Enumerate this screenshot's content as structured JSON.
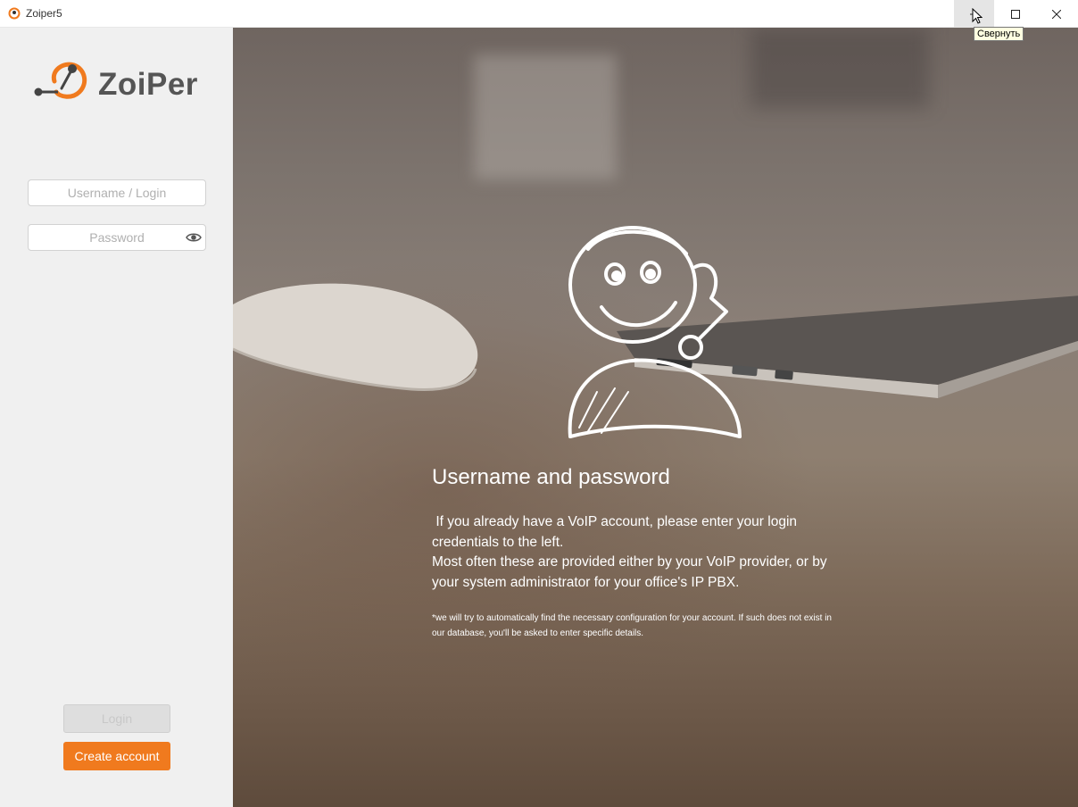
{
  "window": {
    "title": "Zoiper5",
    "tooltip": "Свернуть"
  },
  "sidebar": {
    "logo_text": "ZoiPer",
    "username_placeholder": "Username / Login",
    "password_placeholder": "Password",
    "login_label": "Login",
    "create_account_label": "Create account"
  },
  "hero": {
    "title": "Username and password",
    "body_line1": " If you already have a VoIP account, please enter your login credentials to the left.",
    "body_line2": "Most often these are provided either by your VoIP provider, or by your system administrator for your office's IP PBX.",
    "note": "*we will try to automatically find the necessary configuration for your account. If such does not exist in our database, you'll be asked to enter specific details."
  },
  "colors": {
    "accent": "#f07a1e",
    "sidebar_bg": "#f0f0f0"
  },
  "icons": [
    "zoiper-app-icon",
    "minimize-icon",
    "maximize-icon",
    "close-icon",
    "eye-icon",
    "zoiper-logo-icon",
    "mascot-illustration"
  ]
}
